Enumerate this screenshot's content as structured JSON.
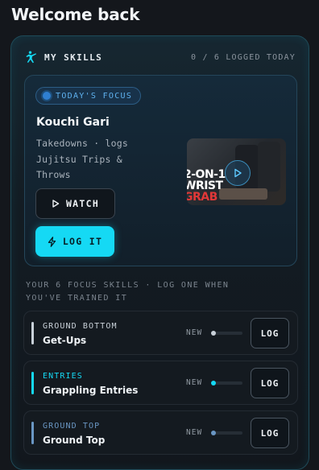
{
  "page": {
    "title": "Welcome back"
  },
  "skills_panel": {
    "title": "MY SKILLS",
    "logged_count": "0 / 6 LOGGED TODAY",
    "header_icon": "martial-arts-kick-icon",
    "accent_color": "#15d9f4"
  },
  "focus": {
    "badge": "TODAY'S FOCUS",
    "skill_name": "Kouchi Gari",
    "description": "Takedowns · logs Jujitsu Trips & Throws",
    "video": {
      "thumbnail_text_line1": "2-ON-1",
      "thumbnail_text_line2": "WRIST",
      "thumbnail_text_line3": "GRAB",
      "play_icon": "play-icon"
    },
    "watch_label": "WATCH",
    "log_it_label": "LOG IT"
  },
  "focus_skills": {
    "heading": "YOUR 6 FOCUS SKILLS · LOG ONE WHEN YOU'VE TRAINED IT",
    "items": [
      {
        "category": "GROUND BOTTOM",
        "name": "Get-Ups",
        "status": "NEW",
        "log_label": "LOG",
        "color": "#c9d1d9",
        "progress": 0.05
      },
      {
        "category": "ENTRIES",
        "name": "Grappling Entries",
        "status": "NEW",
        "log_label": "LOG",
        "color": "#15d9f4",
        "progress": 0.05
      },
      {
        "category": "GROUND TOP",
        "name": "Ground Top",
        "status": "NEW",
        "log_label": "LOG",
        "color": "#6a97c4",
        "progress": 0.05
      }
    ]
  }
}
